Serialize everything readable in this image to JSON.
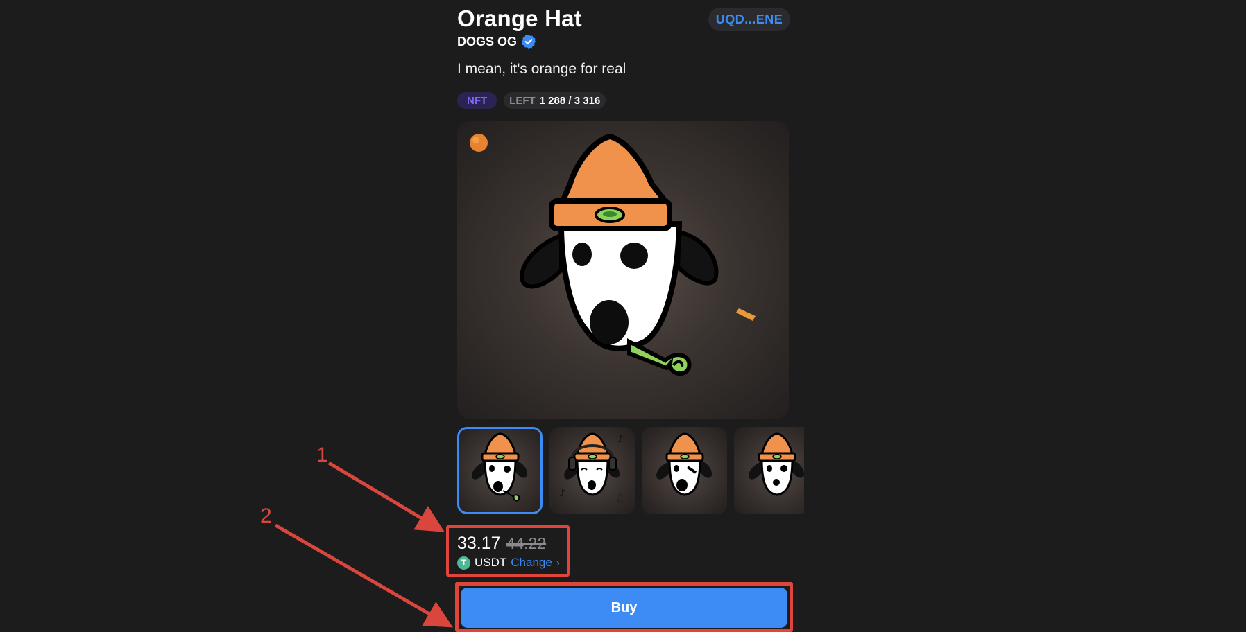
{
  "header": {
    "title": "Orange Hat",
    "wallet_address": "UQD...ENE",
    "collection": "DOGS OG",
    "verified_icon": "verified-check-icon"
  },
  "description": "I mean, it's orange for real",
  "badges": {
    "type": "NFT",
    "left_label": "LEFT",
    "left_value": "1 288 / 3 316"
  },
  "gallery": {
    "main_alt": "Dog character wearing orange hat with party blower",
    "thumbnails": [
      {
        "name": "party-blower-variant",
        "selected": true
      },
      {
        "name": "headphones-variant",
        "selected": false
      },
      {
        "name": "surprised-variant",
        "selected": false
      },
      {
        "name": "plain-variant",
        "selected": false
      }
    ]
  },
  "pricing": {
    "current": "33.17",
    "original": "44.22",
    "token_letter": "T",
    "currency": "USDT",
    "change_label": "Change",
    "change_chevron": "›"
  },
  "actions": {
    "buy_label": "Buy"
  },
  "annotations": {
    "step1": "1",
    "step2": "2"
  },
  "colors": {
    "background": "#1c1c1d",
    "accent": "#3d8bf5",
    "annotation": "#e0453c",
    "nft_badge": "#7b66f5",
    "hat_orange": "#f0924c"
  }
}
